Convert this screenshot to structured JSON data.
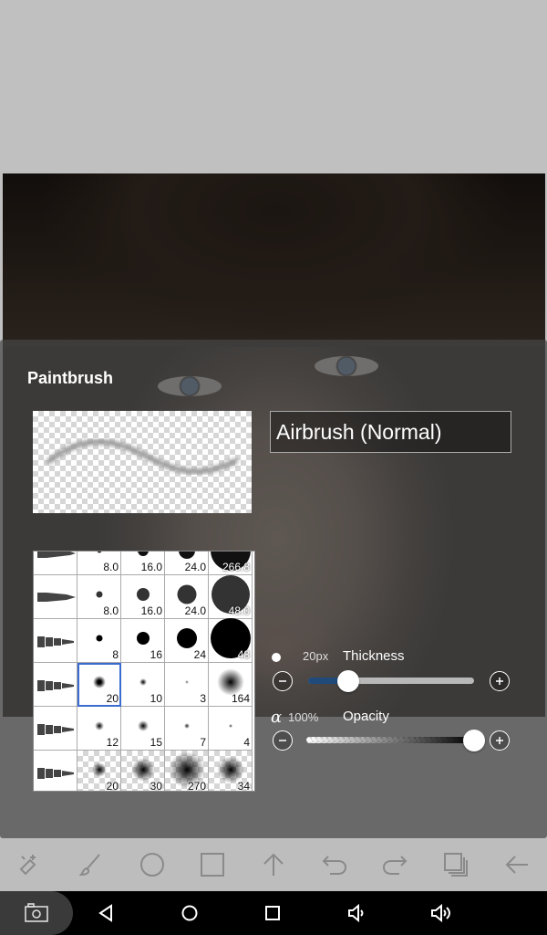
{
  "panel": {
    "title": "Paintbrush",
    "preset_name": "Airbrush (Normal)"
  },
  "thickness": {
    "value_label": "20px",
    "name": "Thickness",
    "level_fraction": 0.24,
    "minus_icon": "minus-icon",
    "plus_icon": "plus-icon"
  },
  "opacity": {
    "alpha_symbol": "α",
    "value_label": "100%",
    "name": "Opacity",
    "level_fraction": 1.0
  },
  "brush_grid": {
    "rows": [
      {
        "cells": [
          "",
          "8.0",
          "16.0",
          "24.0",
          "266.8"
        ]
      },
      {
        "cells": [
          "",
          "8.0",
          "16.0",
          "24.0",
          "48.0"
        ]
      },
      {
        "cells": [
          "",
          "8",
          "16",
          "24",
          "48"
        ]
      },
      {
        "cells": [
          "",
          "20",
          "10",
          "3",
          "164"
        ]
      },
      {
        "cells": [
          "",
          "12",
          "15",
          "7",
          "4"
        ]
      },
      {
        "cells": [
          "",
          "20",
          "30",
          "270",
          "34"
        ]
      }
    ],
    "selected": "20"
  },
  "toolbar": {
    "tools": [
      "transform-icon",
      "brush-icon",
      "ellipse-icon",
      "rectangle-icon",
      "up-arrow-icon",
      "undo-icon",
      "redo-icon",
      "layers-icon",
      "back-arrow-icon"
    ]
  },
  "navbar": {
    "buttons": [
      "screenshot-icon",
      "back-icon",
      "home-icon",
      "recents-icon",
      "volume-down-icon",
      "volume-up-icon"
    ]
  },
  "colors": {
    "accent_slider": "#1f4a7a",
    "selection_outline": "#3a6bd0"
  }
}
